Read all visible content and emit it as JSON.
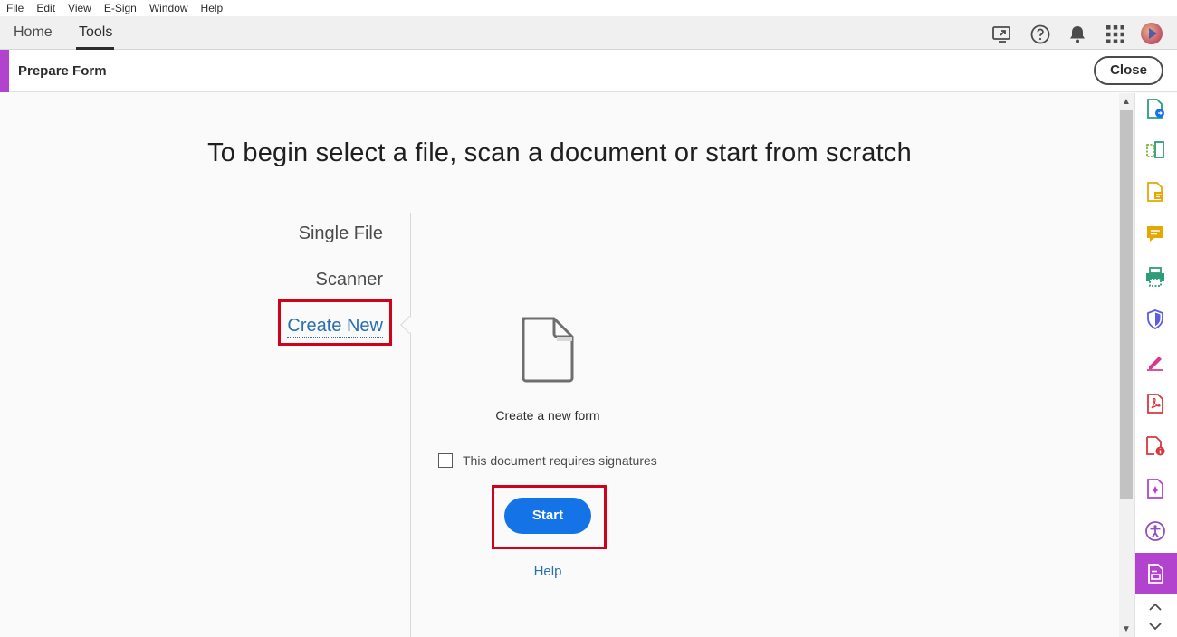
{
  "menu": [
    "File",
    "Edit",
    "View",
    "E-Sign",
    "Window",
    "Help"
  ],
  "tabs": {
    "home": "Home",
    "tools": "Tools"
  },
  "tool": {
    "title": "Prepare Form",
    "close_label": "Close"
  },
  "main": {
    "headline": "To begin select a file, scan a document or start from scratch",
    "options": [
      "Single File",
      "Scanner",
      "Create New"
    ],
    "selected_option": "Create New",
    "create_label": "Create a new form",
    "checkbox_label": "This document requires signatures",
    "checkbox_checked": false,
    "start_label": "Start",
    "help_label": "Help"
  },
  "icons": {
    "top": [
      "share-screen-icon",
      "help-circle-icon",
      "bell-icon",
      "apps-grid-icon"
    ],
    "rail": [
      "create-pdf-icon",
      "organize-pages-icon",
      "export-pdf-icon",
      "comment-icon",
      "print-production-icon",
      "protect-icon",
      "fill-sign-icon",
      "pdf-icon",
      "pdf-info-icon",
      "rich-media-icon",
      "accessibility-icon",
      "prepare-form-icon"
    ]
  },
  "colors": {
    "accent": "#b143cf",
    "primary_button": "#1473e6",
    "highlight_box": "#d0021b",
    "link": "#2a6fb0"
  }
}
